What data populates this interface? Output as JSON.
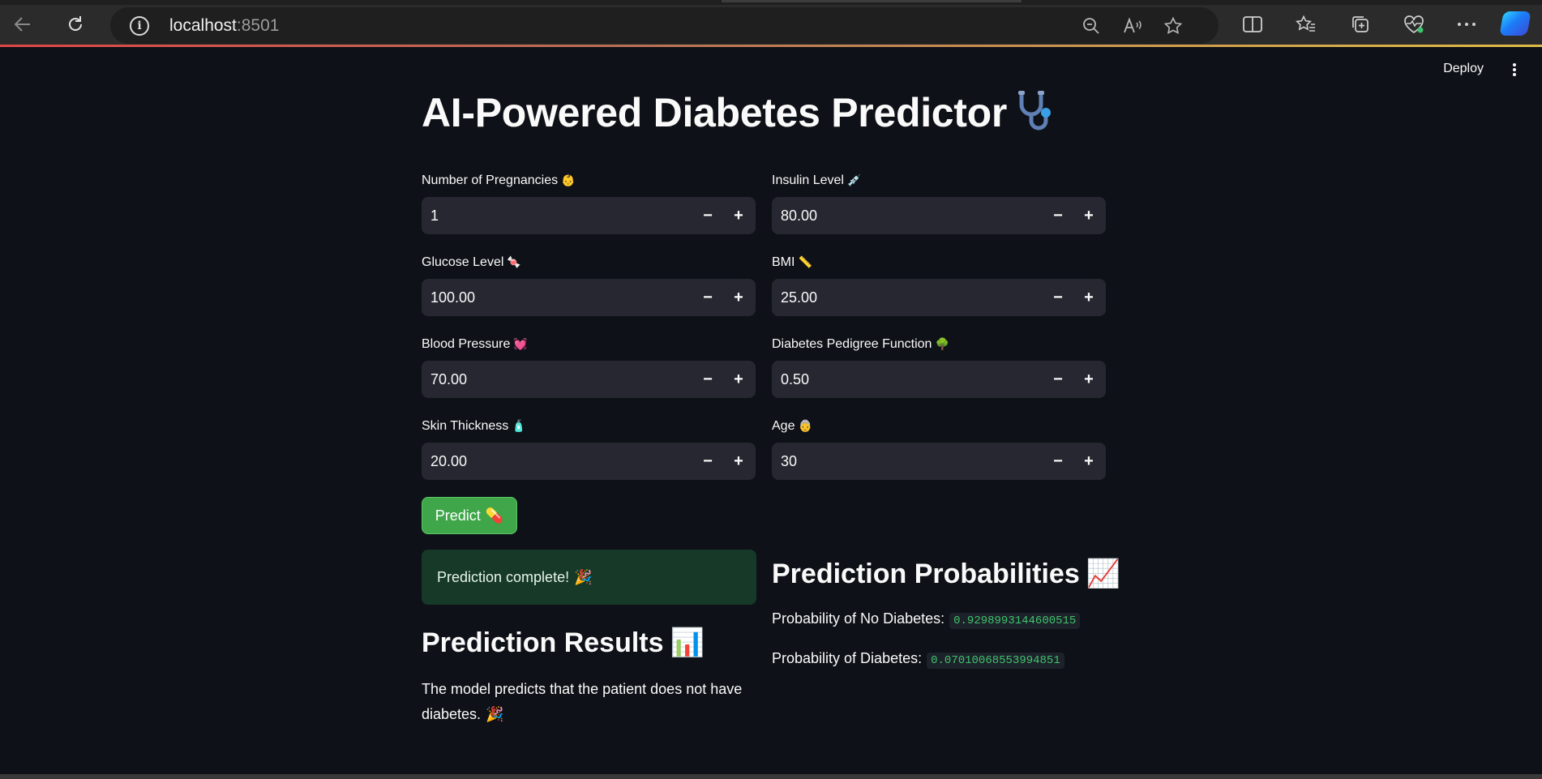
{
  "browser": {
    "url_host": "localhost",
    "url_port": ":8501",
    "icons": {
      "back": "back-arrow-icon",
      "reload": "reload-icon",
      "info": "info-icon",
      "zoom": "zoom-out-icon",
      "read_aloud": "read-aloud-icon",
      "favorite": "star-icon",
      "split": "split-screen-icon",
      "favorites": "favorites-icon",
      "collections": "collections-icon",
      "health": "browser-essentials-icon",
      "more": "more-icon",
      "copilot": "copilot-icon"
    }
  },
  "header": {
    "deploy_label": "Deploy"
  },
  "page": {
    "title": "AI-Powered Diabetes Predictor"
  },
  "form": {
    "pregnancies": {
      "label": "Number of Pregnancies",
      "value": "1"
    },
    "glucose": {
      "label": "Glucose Level",
      "value": "100.00"
    },
    "blood_pressure": {
      "label": "Blood Pressure",
      "value": "70.00"
    },
    "skin_thickness": {
      "label": "Skin Thickness",
      "value": "20.00"
    },
    "insulin": {
      "label": "Insulin Level",
      "value": "80.00"
    },
    "bmi": {
      "label": "BMI",
      "value": "25.00"
    },
    "dpf": {
      "label": "Diabetes Pedigree Function",
      "value": "0.50"
    },
    "age": {
      "label": "Age",
      "value": "30"
    },
    "minus_symbol": "−",
    "plus_symbol": "+"
  },
  "predict_button": {
    "label": "Predict"
  },
  "success_message": "Prediction complete!",
  "results": {
    "heading": "Prediction Results",
    "text": "The model predicts that the patient does not have diabetes."
  },
  "probabilities": {
    "heading": "Prediction Probabilities",
    "no_diabetes_label": "Probability of No Diabetes:",
    "no_diabetes_value": "0.9298993144600515",
    "diabetes_label": "Probability of Diabetes:",
    "diabetes_value": "0.07010068553994851"
  },
  "colors": {
    "background": "#0e1117",
    "input_bg": "#262730",
    "button_green": "#3fa64a",
    "success_bg": "#173928",
    "code_green": "#3ec46d"
  }
}
